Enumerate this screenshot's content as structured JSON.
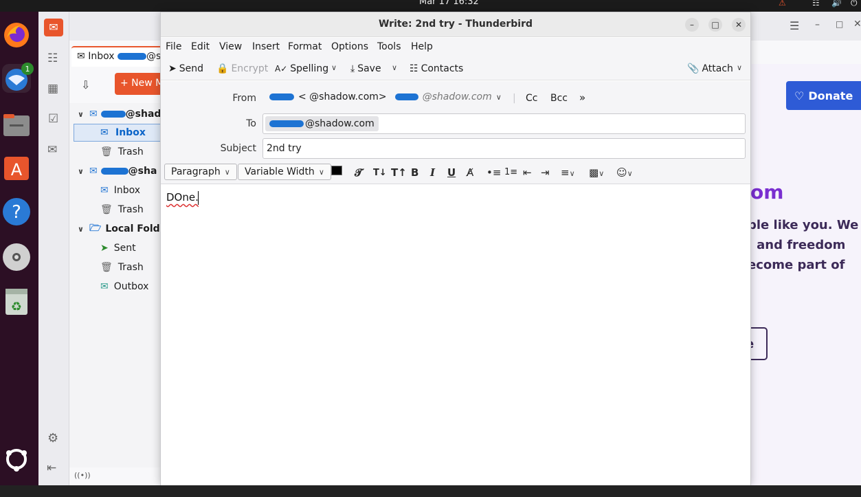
{
  "topbar": {
    "clock": "Mar 17  16:32"
  },
  "dock": {
    "thunderbird_badge": "1"
  },
  "main_window": {
    "tab_label": "Inbox",
    "tab_suffix": "@s",
    "new_message_label": "+ New M",
    "accounts": [
      {
        "name_suffix": "@shad",
        "folders": [
          "Inbox",
          "Trash"
        ]
      },
      {
        "name_suffix": "@sha",
        "folders": [
          "Inbox",
          "Trash"
        ]
      }
    ],
    "local_folders_label": "Local Folde",
    "local_folders": [
      "Sent",
      "Trash",
      "Outbox"
    ]
  },
  "webpage": {
    "donate_label": "Donate",
    "heading_fragment": "om",
    "text_lines": [
      "ple like you. We",
      ", and freedom",
      "ecome part of"
    ],
    "button_fragment": "e"
  },
  "compose": {
    "title": "Write: 2nd try - Thunderbird",
    "menu": [
      "File",
      "Edit",
      "View",
      "Insert",
      "Format",
      "Options",
      "Tools",
      "Help"
    ],
    "toolbar": {
      "send": "Send",
      "encrypt": "Encrypt",
      "spelling": "Spelling",
      "save": "Save",
      "contacts": "Contacts",
      "attach": "Attach"
    },
    "from_label": "From",
    "from_value": "<        @shadow.com>",
    "from_identity": "@shadow.com",
    "cc_label": "Cc",
    "bcc_label": "Bcc",
    "to_label": "To",
    "to_value": "@shadow.com",
    "subject_label": "Subject",
    "subject_value": "2nd try",
    "format": {
      "paragraph": "Paragraph",
      "font": "Variable Width"
    },
    "body": "DOne."
  },
  "colors": {
    "accent_orange": "#e8552c",
    "donate_blue": "#2e5bd6",
    "redaction_blue": "#1d73d3",
    "selection_blue": "#0a64c8"
  }
}
